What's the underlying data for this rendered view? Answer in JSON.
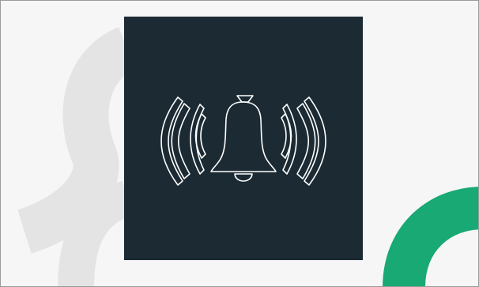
{
  "illustration": {
    "icon": "ringing-bell-icon",
    "colors": {
      "page_background": "#f6f6f6",
      "card_background": "#1b2a33",
      "line_art": "#ffffff",
      "grey_curve": "#e4e4e4",
      "green_arc": "#19a974",
      "border": "#9a9a9a"
    }
  }
}
